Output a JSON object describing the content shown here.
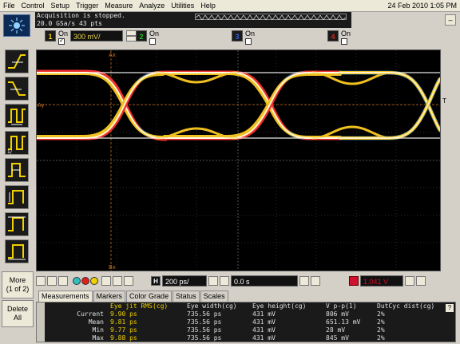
{
  "menu": [
    "File",
    "Control",
    "Setup",
    "Trigger",
    "Measure",
    "Analyze",
    "Utilities",
    "Help"
  ],
  "datetime": "24 Feb 2010  1:05 PM",
  "status": {
    "line1": "Acquisition is stopped.",
    "line2": "20.0 GSa/s   43 pts"
  },
  "minimize_label": "–",
  "channels": [
    {
      "num": "1",
      "on_label": "On",
      "checked": true,
      "scale": "300 mV/",
      "color": "#f0d000"
    },
    {
      "num": "2",
      "on_label": "On",
      "checked": false,
      "color": "#20c020"
    },
    {
      "num": "3",
      "on_label": "On",
      "checked": false,
      "color": "#3060e0"
    },
    {
      "num": "4",
      "on_label": "On",
      "checked": false,
      "color": "#e02020"
    }
  ],
  "graticule": {
    "marker_top": "Ax",
    "marker_bottom": "Bx",
    "marker_left": "Ay",
    "marker_right": "T"
  },
  "timebase": {
    "scale": "200 ps/",
    "delay": "0.0 s",
    "trigger_level": "1.041 V"
  },
  "side_buttons": {
    "more": "More",
    "more_sub": "(1 of 2)",
    "delete": "Delete",
    "delete_sub": "All"
  },
  "tabs": [
    "Measurements",
    "Markers",
    "Color Grade",
    "Status",
    "Scales"
  ],
  "measurements": {
    "headers": [
      "",
      "Eye jit RMS(cg)",
      "Eye width(cg)",
      "Eye height(cg)",
      "V p-p(1)",
      "DutCyc dist(cg)"
    ],
    "rows": [
      [
        "Current",
        "9.90 ps",
        "735.56 ps",
        "431 mV",
        "806 mV",
        "2%"
      ],
      [
        "Mean",
        "9.81 ps",
        "735.56 ps",
        "431 mV",
        "651.13 mV",
        "2%"
      ],
      [
        "Min",
        "9.77 ps",
        "735.56 ps",
        "431 mV",
        "28 mV",
        "2%"
      ],
      [
        "Max",
        "9.88 ps",
        "735.56 ps",
        "431 mV",
        "845 mV",
        "2%"
      ]
    ]
  },
  "help_label": "?"
}
